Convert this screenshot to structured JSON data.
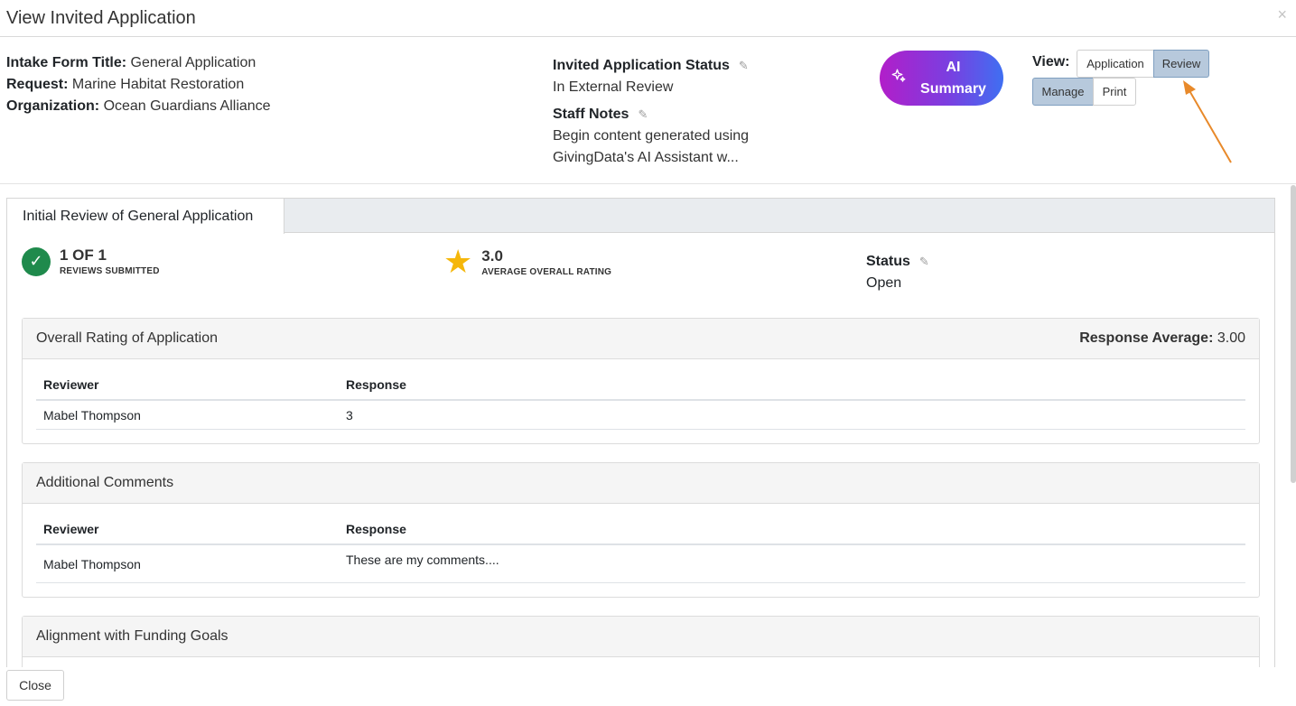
{
  "modal": {
    "title": "View Invited Application",
    "close_icon": "×",
    "close_button": "Close"
  },
  "info": {
    "intake_label": "Intake Form Title:",
    "intake_value": "General Application",
    "request_label": "Request:",
    "request_value": "Marine Habitat Restoration",
    "org_label": "Organization:",
    "org_value": "Ocean Guardians Alliance"
  },
  "application_status": {
    "label": "Invited Application Status",
    "value": "In External Review"
  },
  "staff_notes": {
    "label": "Staff Notes",
    "value_line1": "Begin content generated using",
    "value_line2": "GivingData's AI Assistant w..."
  },
  "ai_button": {
    "line1": "AI",
    "line2": "Summary",
    "icon": "sparkle-icon"
  },
  "view_toggle": {
    "label": "View:",
    "application": "Application",
    "review": "Review",
    "manage": "Manage",
    "print": "Print",
    "active": [
      "Review",
      "Manage"
    ]
  },
  "tab": {
    "label": "Initial Review of General Application"
  },
  "stats": {
    "reviews_count": "1 OF 1",
    "reviews_caption": "REVIEWS SUBMITTED",
    "rating_value": "3.0",
    "rating_caption": "AVERAGE OVERALL RATING",
    "status_label": "Status",
    "status_value": "Open"
  },
  "cards": [
    {
      "title": "Overall Rating of Application",
      "avg_label": "Response Average:",
      "avg_value": "3.00",
      "col_reviewer": "Reviewer",
      "col_response": "Response",
      "rows": [
        {
          "reviewer": "Mabel Thompson",
          "response": "3"
        }
      ]
    },
    {
      "title": "Additional Comments",
      "col_reviewer": "Reviewer",
      "col_response": "Response",
      "rows": [
        {
          "reviewer": "Mabel Thompson",
          "response": "These are my comments...."
        }
      ]
    },
    {
      "title": "Alignment with Funding Goals"
    }
  ],
  "colors": {
    "accent_start": "#b21ec9",
    "accent_end": "#3f6ff2",
    "active_toggle": "#b7c9dc",
    "check_green": "#1f8a4c",
    "star": "#f5b70b",
    "arrow": "#e8892a"
  }
}
